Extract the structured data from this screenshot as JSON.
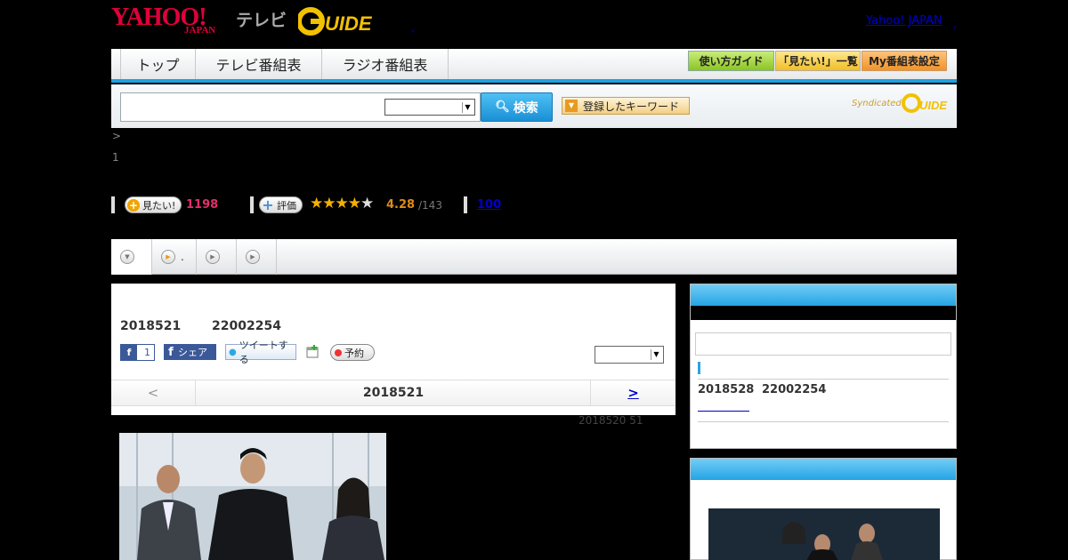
{
  "header": {
    "yahoo_logo": "YAHOO!",
    "japan_logo": "JAPAN",
    "tv_label": "テレビ",
    "gguide_logo": "G-GUIDE",
    "yahoo_japan_link": "Yahoo! JAPAN",
    "dot1": ",",
    "dot2": ","
  },
  "nav": {
    "tabs": [
      {
        "label": "トップ"
      },
      {
        "label": "テレビ番組表"
      },
      {
        "label": "ラジオ番組表"
      }
    ],
    "guide_buttons": [
      {
        "label": "使い方ガイド",
        "color": "#9fd23a"
      },
      {
        "label": "「見たい!」一覧",
        "color": "#f2c02a"
      },
      {
        "label": "My番組表設定",
        "color": "#f39a2a"
      }
    ]
  },
  "search": {
    "input_value": "",
    "select_value": "",
    "button_label": "検索",
    "keyword_button_label": "登録したキーワード",
    "syndicated_label": "Syndicated"
  },
  "breadcrumb": {
    "text": ">",
    "line2": "1"
  },
  "stats": {
    "want_label": "見たい!",
    "want_count": "1198",
    "rate_label": "評価",
    "stars": "★★★★",
    "star_empty": "★",
    "rating": "4.28",
    "rating_count": "/143",
    "link_100": "100"
  },
  "content_tabs": [
    {
      "label": "",
      "icon": "chevron-down-icon"
    },
    {
      "label": ".",
      "icon": "play-icon"
    },
    {
      "label": "",
      "icon": "play-icon"
    },
    {
      "label": "",
      "icon": "play-icon"
    }
  ],
  "program": {
    "date": "2018521",
    "time": "22002254",
    "fb_like_count": "1",
    "share_label": "シェア",
    "tweet_label": "ツイートする",
    "reserve_label": "予約",
    "select_value": ""
  },
  "day_nav": {
    "prev": "<",
    "current": "2018521",
    "next": ">"
  },
  "updated": "2018520  51",
  "sidebar": {
    "next_date": "2018528",
    "next_time": "22002254"
  },
  "colors": {
    "accent_blue": "#1fa1e0",
    "want_red": "#e0306b",
    "star_gold": "#f3b000"
  }
}
